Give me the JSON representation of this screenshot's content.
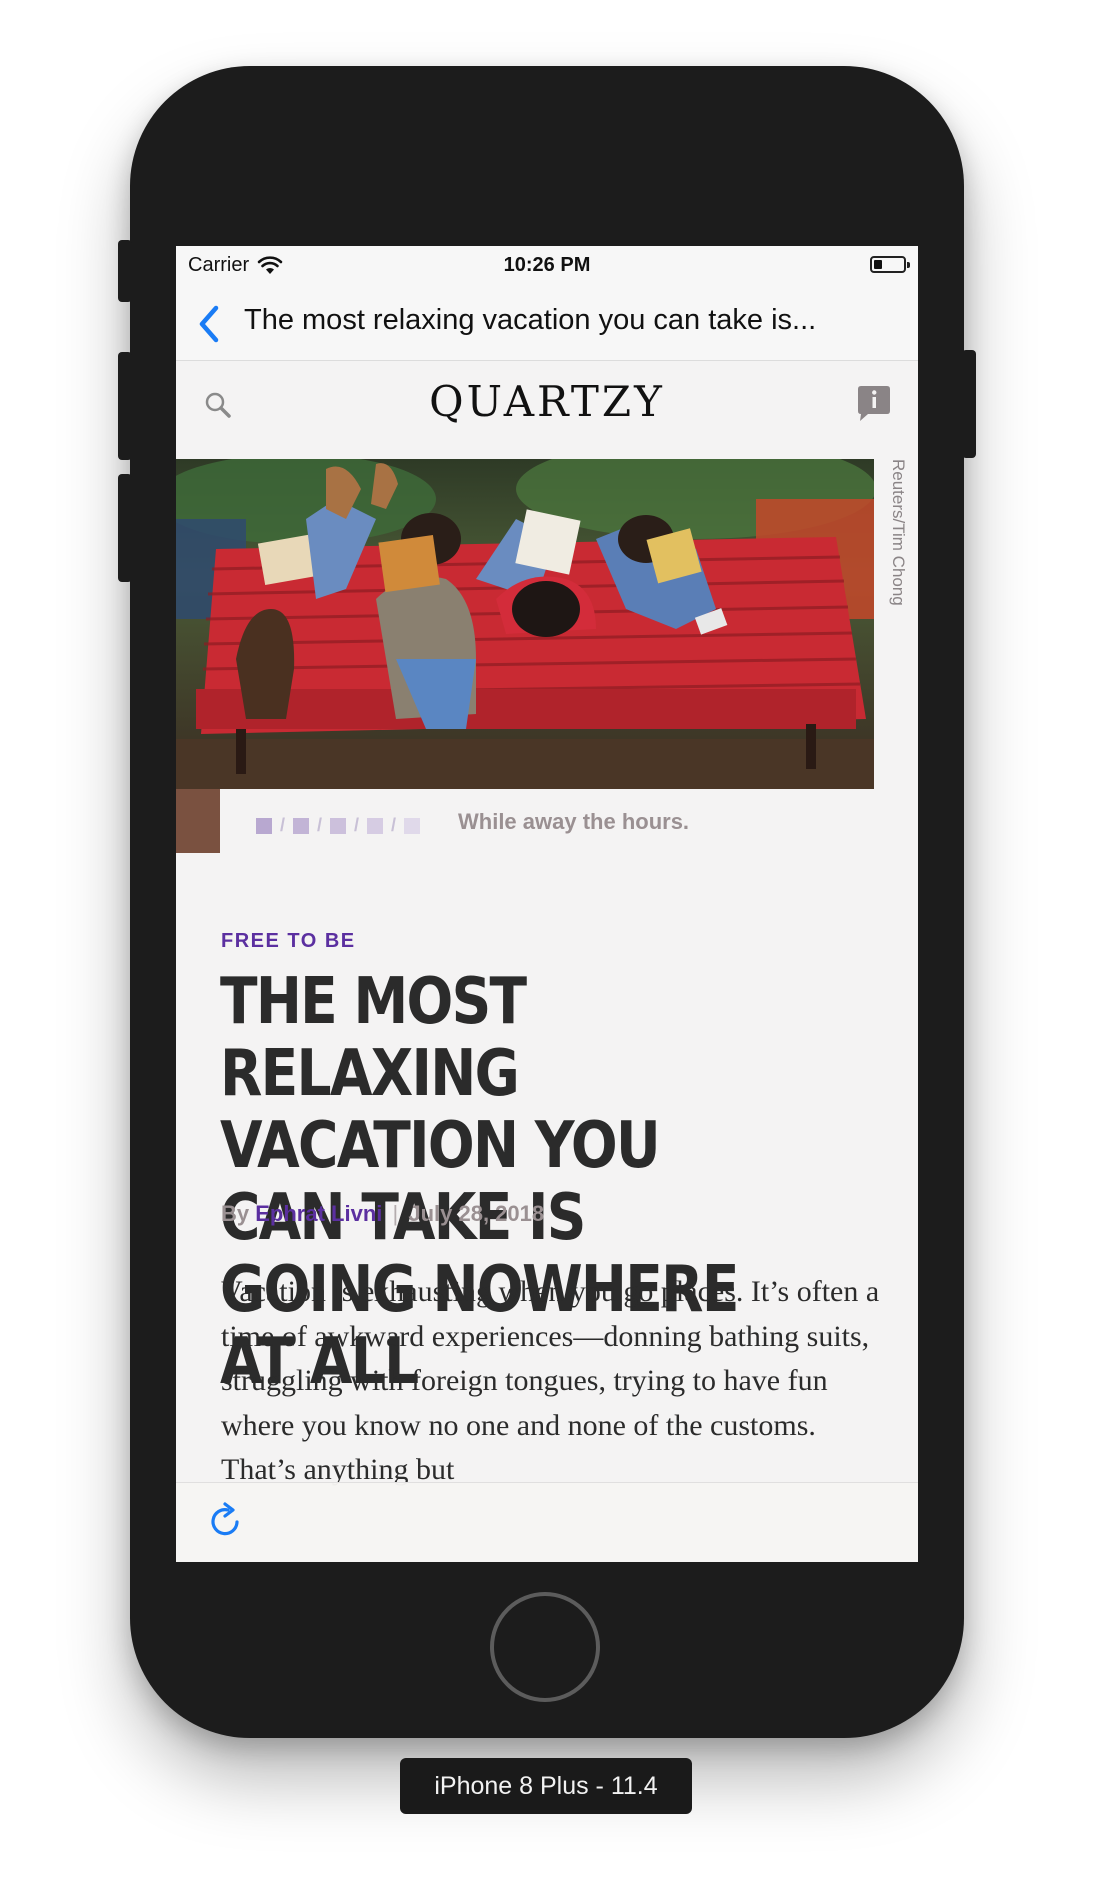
{
  "status_bar": {
    "carrier": "Carrier",
    "time": "10:26 PM"
  },
  "nav": {
    "back_icon": "chevron-left",
    "title": "The most relaxing vacation you can take is..."
  },
  "site": {
    "logo": "QUARTZY",
    "search_icon": "search",
    "info_icon": "info-bubble"
  },
  "hero": {
    "credit": "Reuters/Tim Chong",
    "caption": "While away the hours."
  },
  "article": {
    "kicker": "FREE TO BE",
    "headline": "THE MOST RELAXING VACATION YOU CAN TAKE IS GOING NOWHERE AT ALL",
    "byline_prefix": "By",
    "author": "Ephrat Livni",
    "separator": "|",
    "date": "July 28, 2018",
    "body": "Vacation is exhausting when you go places. It’s often a time of awkward experiences—donning bathing suits, struggling with foreign tongues, trying to have fun where you know no one and none of the customs. That’s anything but"
  },
  "toolbar": {
    "refresh_icon": "refresh"
  },
  "device": {
    "label": "iPhone 8 Plus - 11.4"
  },
  "colors": {
    "accent": "#5b2fa0",
    "ios_blue": "#1a7cf5",
    "headline": "#2b2b2b"
  }
}
